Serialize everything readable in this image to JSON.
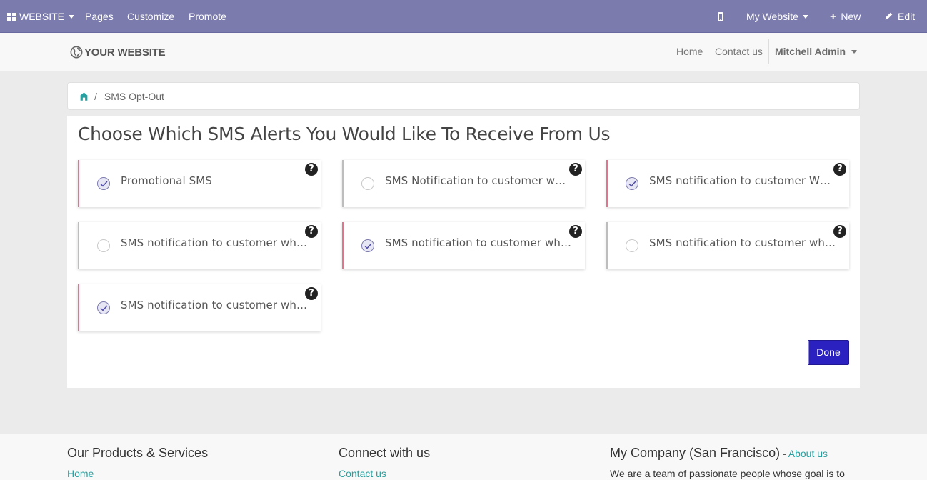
{
  "adminbar": {
    "apps_label": "WEBSITE",
    "pages": "Pages",
    "customize": "Customize",
    "promote": "Promote",
    "website_selector": "My Website",
    "new_label": "New",
    "edit_label": "Edit",
    "color": "#7c7bad"
  },
  "header": {
    "logo_text": "YOUR WEBSITE",
    "nav": [
      "Home",
      "Contact us"
    ],
    "user": "Mitchell Admin"
  },
  "breadcrumb": {
    "current": "SMS Opt-Out"
  },
  "main": {
    "title": "Choose Which SMS Alerts You Would Like To Receive From Us",
    "options": [
      {
        "label": "Promotional SMS",
        "checked": true
      },
      {
        "label": "SMS Notification to customer when...",
        "checked": false
      },
      {
        "label": "SMS notification to customer When...",
        "checked": true
      },
      {
        "label": "SMS notification to customer when ...",
        "checked": false
      },
      {
        "label": "SMS notification to customer when ...",
        "checked": true
      },
      {
        "label": "SMS notification to customer when ...",
        "checked": false
      },
      {
        "label": "SMS notification to customer when ...",
        "checked": true
      }
    ],
    "help_glyph": "?",
    "done_label": "Done",
    "accent_checked": "#e5738b",
    "button_color": "#2b21c0"
  },
  "footer": {
    "col1_title": "Our Products & Services",
    "col1_link": "Home",
    "col2_title": "Connect with us",
    "col2_link": "Contact us",
    "col3_title": "My Company (San Francisco)",
    "col3_dash": " - ",
    "col3_about": "About us",
    "col3_text": "We are a team of passionate people whose goal is to"
  }
}
